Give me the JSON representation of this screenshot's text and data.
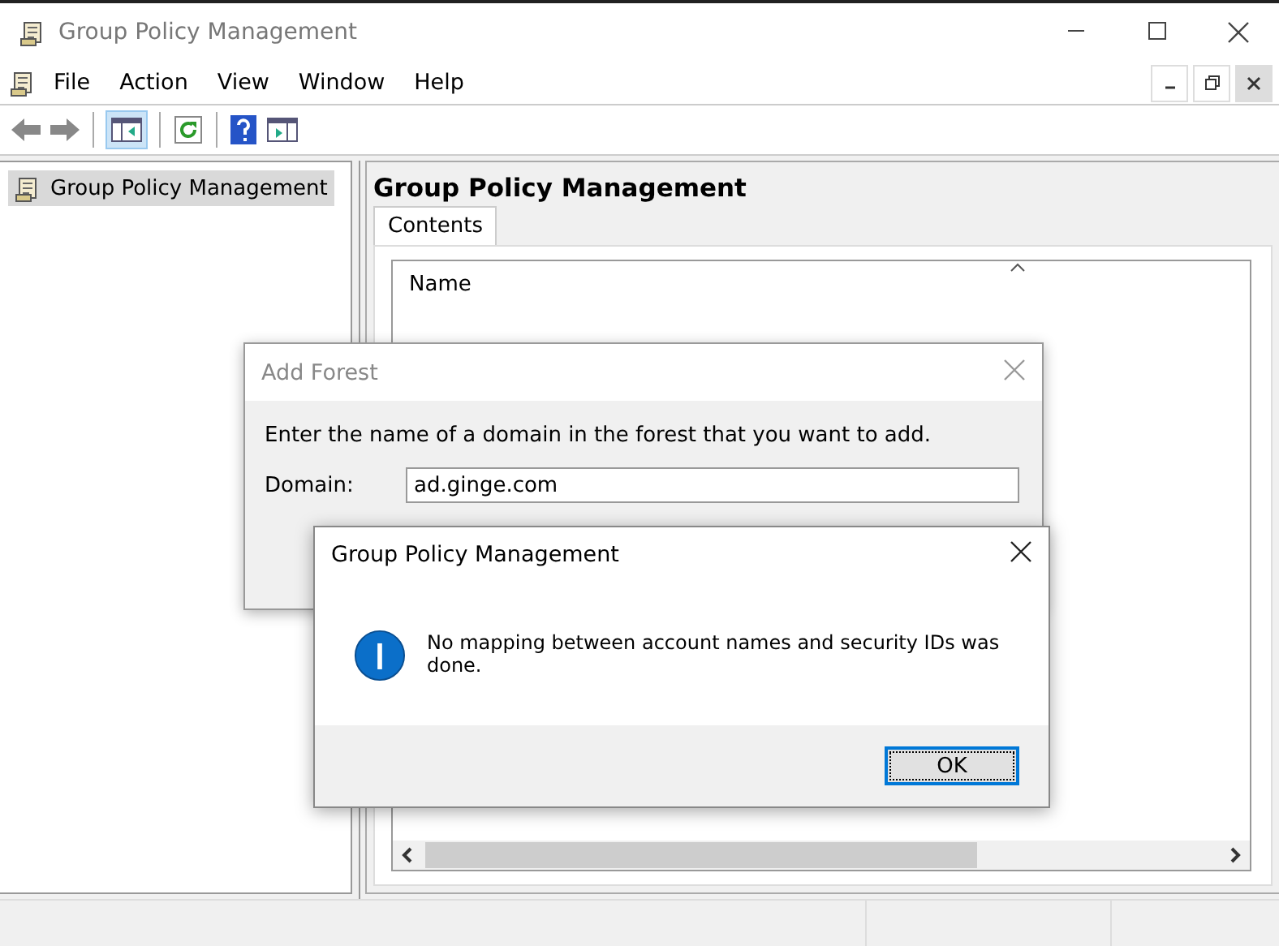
{
  "window": {
    "title": "Group Policy Management"
  },
  "menu": [
    "File",
    "Action",
    "View",
    "Window",
    "Help"
  ],
  "tree": {
    "items": [
      {
        "label": "Group Policy Management",
        "selected": true
      }
    ]
  },
  "details": {
    "title": "Group Policy Management",
    "tabs": [
      {
        "label": "Contents",
        "selected": true
      }
    ],
    "columns": [
      "Name"
    ]
  },
  "add_forest_dialog": {
    "title": "Add Forest",
    "prompt": "Enter the name of a domain in the forest that you want to add.",
    "domain_label": "Domain:",
    "domain_value": "ad.ginge.com"
  },
  "message_box": {
    "title": "Group Policy Management",
    "message": "No mapping between account names and security IDs was done.",
    "buttons": [
      {
        "label": "OK",
        "focused": true
      }
    ]
  }
}
